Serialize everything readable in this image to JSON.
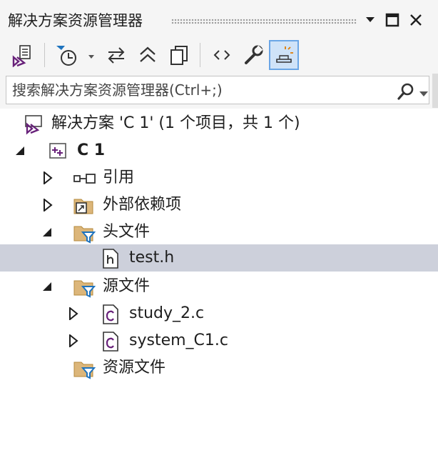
{
  "panel": {
    "title": "解决方案资源管理器"
  },
  "search": {
    "placeholder": "搜索解决方案资源管理器(Ctrl+;)"
  },
  "tree": {
    "solution_label": "解决方案 'C 1' (1 个项目，共 1 个)",
    "project_label": "C 1",
    "references_label": "引用",
    "external_deps_label": "外部依赖项",
    "header_files_label": "头文件",
    "test_h_label": "test.h",
    "source_files_label": "源文件",
    "study_c_label": "study_2.c",
    "system_c_label": "system_C1.c",
    "resource_files_label": "资源文件"
  },
  "colors": {
    "selected_row": "#cdd0db",
    "folder": "#dcb67a",
    "filter": "#1e73be",
    "vs_purple": "#68217a"
  }
}
